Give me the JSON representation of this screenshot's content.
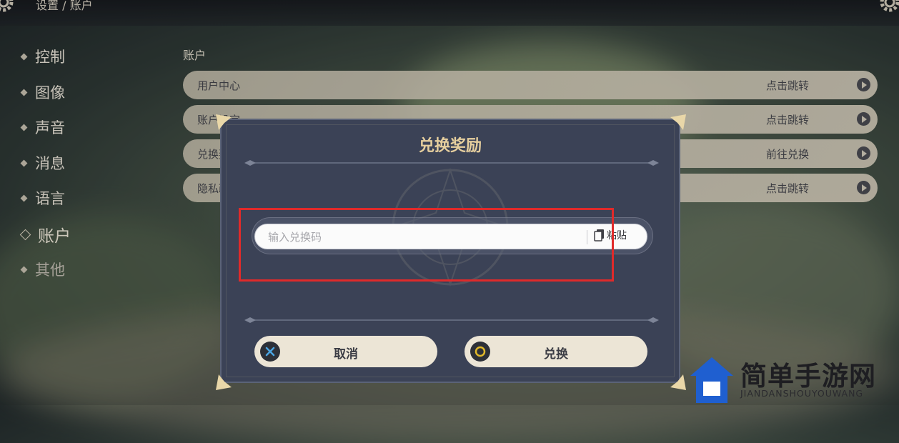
{
  "breadcrumb": "设置 / 账户",
  "sidebar": {
    "items": [
      {
        "label": "控制"
      },
      {
        "label": "图像"
      },
      {
        "label": "声音"
      },
      {
        "label": "消息"
      },
      {
        "label": "语言"
      },
      {
        "label": "账户",
        "active": true
      },
      {
        "label": "其他"
      }
    ]
  },
  "section_title": "账户",
  "rows": [
    {
      "label": "用户中心",
      "action": "点击跳转"
    },
    {
      "label": "账户设定",
      "action": "点击跳转"
    },
    {
      "label": "兑换奖励",
      "action": "前往兑换"
    },
    {
      "label": "隐私政策",
      "action": "点击跳转"
    }
  ],
  "dialog": {
    "title": "兑换奖励",
    "input_placeholder": "输入兑换码",
    "paste_label": "粘贴",
    "cancel_label": "取消",
    "confirm_label": "兑换"
  },
  "watermark": {
    "title": "简单手游网",
    "subtitle": "JIANDANSHOUYOUWANG"
  },
  "colors": {
    "highlight": "#e02a2a",
    "dialog_bg": "#3b4256",
    "title_gold": "#e6cf9e",
    "cancel_icon": "#4aa3e0",
    "confirm_icon": "#e0b82a"
  }
}
